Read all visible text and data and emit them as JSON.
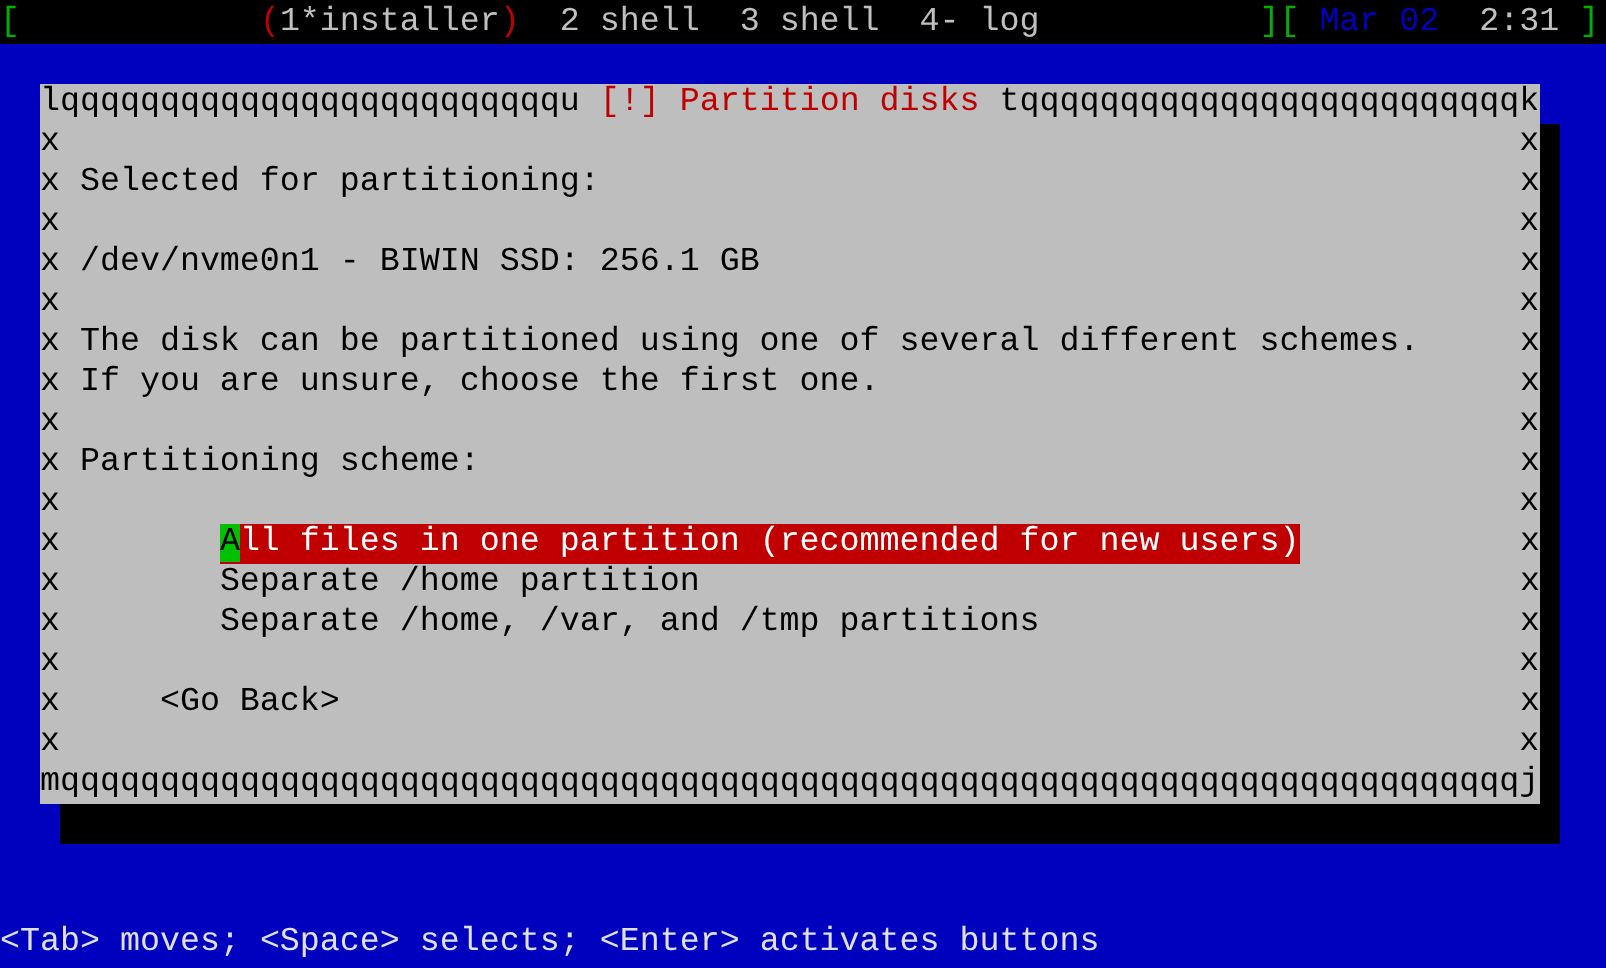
{
  "status_bar": {
    "left_bracket": "[",
    "windows": [
      {
        "label": "(1*installer)",
        "selected": true
      },
      {
        "label": "2 shell",
        "selected": false
      },
      {
        "label": "3 shell",
        "selected": false
      },
      {
        "label": "4- log",
        "selected": false
      }
    ],
    "middle_brackets": "][",
    "date": "Mar 02",
    "time": "2:31",
    "right_bracket": "]"
  },
  "dialog": {
    "border_top_left": "lqqqqqqqqqqqqqqqqqqqqqqqqqu",
    "title": "[!] Partition disks",
    "border_top_right": "tqqqqqqqqqqqqqqqqqqqqqqqqqk",
    "lines": [
      {
        "kind": "blank",
        "left": "x",
        "right": "x"
      },
      {
        "kind": "text",
        "text": "Selected for partitioning:",
        "left": "x",
        "right": "x"
      },
      {
        "kind": "blank",
        "left": "x",
        "right": "x"
      },
      {
        "kind": "text",
        "text": "/dev/nvme0n1 - BIWIN SSD: 256.1 GB",
        "left": "x",
        "right": "x"
      },
      {
        "kind": "blank",
        "left": "x",
        "right": "x"
      },
      {
        "kind": "text",
        "text": "The disk can be partitioned using one of several different schemes.",
        "left": "x",
        "right": "x"
      },
      {
        "kind": "text",
        "text": "If you are unsure, choose the first one.",
        "left": "x",
        "right": "x"
      },
      {
        "kind": "blank",
        "left": "x",
        "right": "x"
      },
      {
        "kind": "text",
        "text": "Partitioning scheme:",
        "left": "x",
        "right": "x"
      },
      {
        "kind": "blank",
        "left": "x",
        "right": "x"
      },
      {
        "kind": "option",
        "text": "All files in one partition (recommended for new users)",
        "selected": true,
        "left": "x",
        "right": "x"
      },
      {
        "kind": "option",
        "text": "Separate /home partition",
        "selected": false,
        "left": "x",
        "right": "x"
      },
      {
        "kind": "option",
        "text": "Separate /home, /var, and /tmp partitions",
        "selected": false,
        "left": "x",
        "right": "x"
      },
      {
        "kind": "blank",
        "left": "x",
        "right": "x"
      },
      {
        "kind": "button",
        "text": "<Go Back>",
        "left": "x",
        "right": "x"
      },
      {
        "kind": "blank",
        "left": "x",
        "right": "x"
      }
    ],
    "border_bottom": "mqqqqqqqqqqqqqqqqqqqqqqqqqqqqqqqqqqqqqqqqqqqqqqqqqqqqqqqqqqqqqqqqqqqqqqqqqj"
  },
  "help_line": "<Tab> moves; <Space> selects; <Enter> activates buttons"
}
